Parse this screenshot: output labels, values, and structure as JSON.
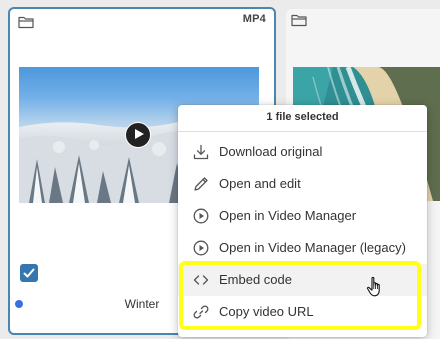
{
  "cards": [
    {
      "format": "MP4",
      "title": "Winter",
      "selected": true,
      "thumbnail": "snowy-forest-video-thumbnail",
      "icon": "folder-icon"
    },
    {
      "thumbnail": "beach-aerial-image-thumbnail",
      "icon": "folder-icon"
    }
  ],
  "context_menu": {
    "header": "1 file selected",
    "items": [
      {
        "label": "Download original",
        "icon": "download-icon"
      },
      {
        "label": "Open and edit",
        "icon": "pencil-icon"
      },
      {
        "label": "Open in Video Manager",
        "icon": "play-circle-icon"
      },
      {
        "label": "Open in Video Manager (legacy)",
        "icon": "play-circle-icon"
      },
      {
        "label": "Embed code",
        "icon": "code-icon"
      },
      {
        "label": "Copy video URL",
        "icon": "link-icon"
      }
    ]
  },
  "colors": {
    "selected_border": "#4a86b0",
    "checkbox": "#3576ae",
    "status_dot": "#3a6fe2",
    "highlight": "#ffff1a",
    "hover_row": "#f2f2f2"
  }
}
